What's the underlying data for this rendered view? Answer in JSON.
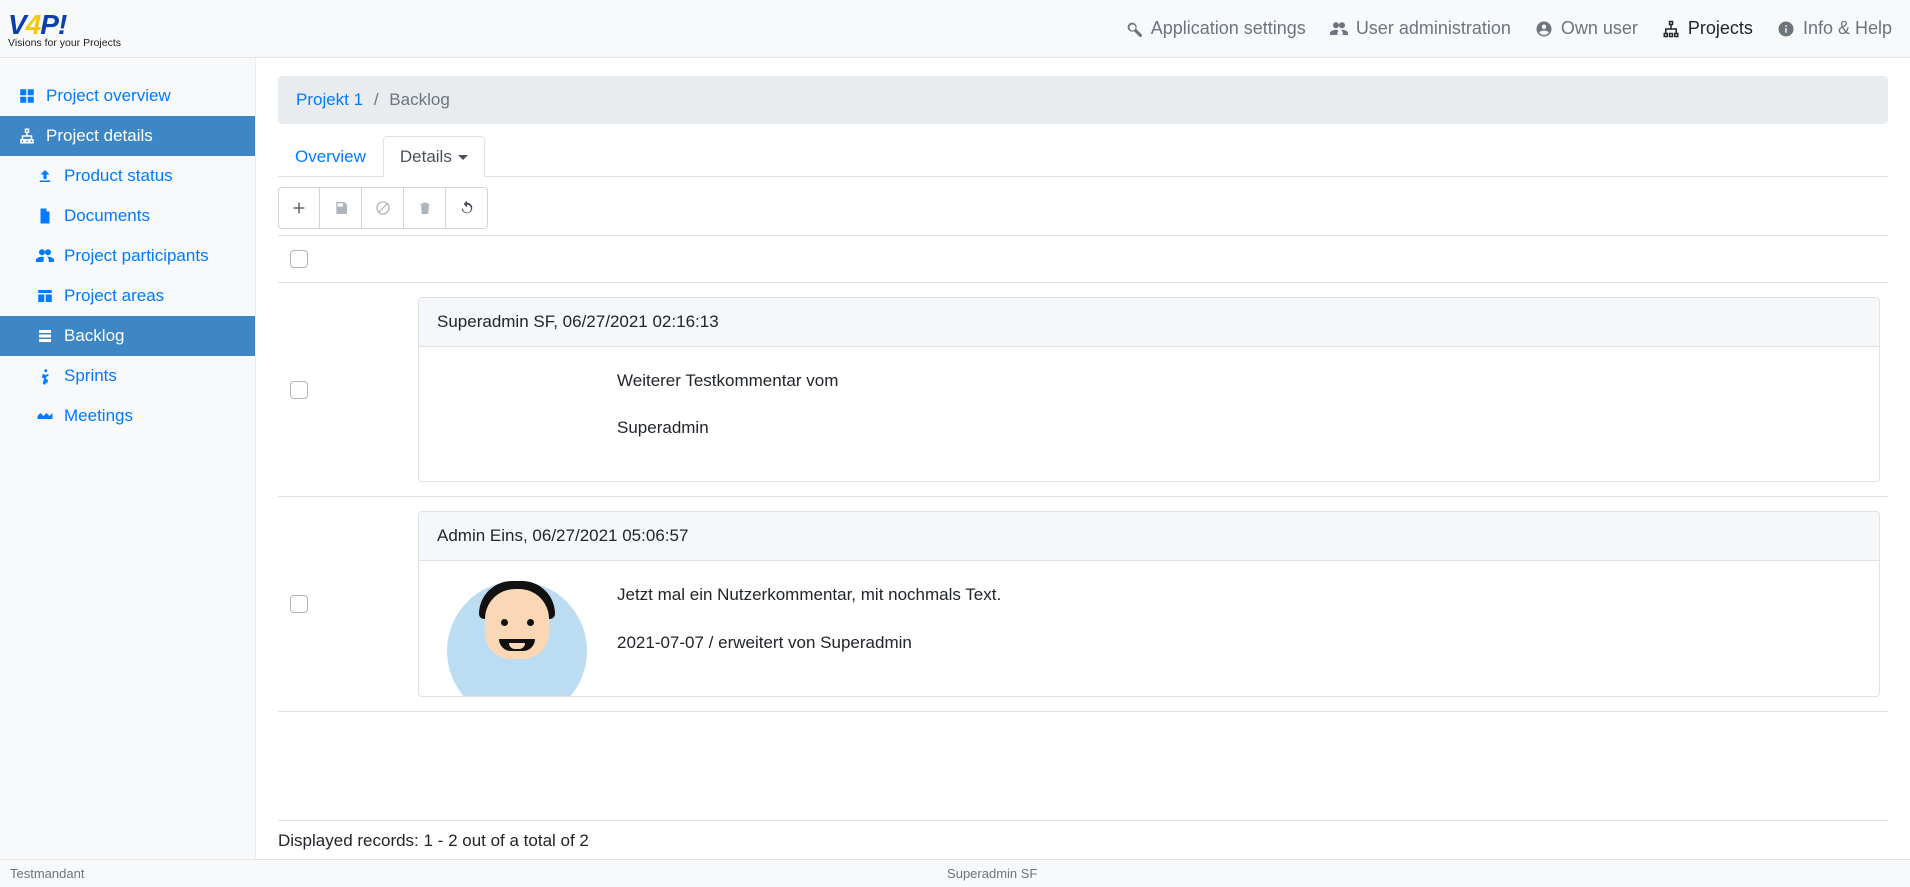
{
  "topnav": {
    "logo_main": "V4P!",
    "logo_sub": "Visions for your Projects",
    "items": {
      "settings": "Application settings",
      "users": "User administration",
      "own": "Own user",
      "projects": "Projects",
      "help": "Info & Help"
    }
  },
  "sidebar": {
    "overview": "Project overview",
    "details": "Project details",
    "children": {
      "product_status": "Product status",
      "documents": "Documents",
      "participants": "Project participants",
      "areas": "Project areas",
      "backlog": "Backlog",
      "sprints": "Sprints",
      "meetings": "Meetings"
    }
  },
  "breadcrumb": {
    "project": "Projekt 1",
    "current": "Backlog"
  },
  "tabs": {
    "overview": "Overview",
    "details": "Details"
  },
  "rows": [
    {
      "header": "Superadmin SF, 06/27/2021 02:16:13",
      "body_lines": [
        "Weiterer Testkommentar vom",
        "Superadmin"
      ],
      "avatar": false
    },
    {
      "header": "Admin Eins, 06/27/2021 05:06:57",
      "body_lines": [
        "Jetzt mal ein Nutzerkommentar, mit nochmals Text.",
        "2021-07-07 / erweitert von Superadmin"
      ],
      "avatar": true
    }
  ],
  "records": "Displayed records: 1 - 2 out of a total of 2",
  "footer": {
    "tenant": "Testmandant",
    "user": "Superadmin SF"
  }
}
